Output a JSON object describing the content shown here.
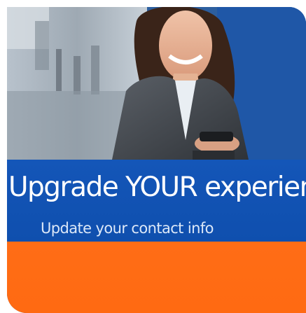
{
  "promo": {
    "headline": "Upgrade YOUR experience",
    "subline": "Update your contact info",
    "photo": "woman-using-phone-photo",
    "colors": {
      "banner_blue": "#1456b8",
      "accent_orange": "#ff6a12"
    }
  }
}
